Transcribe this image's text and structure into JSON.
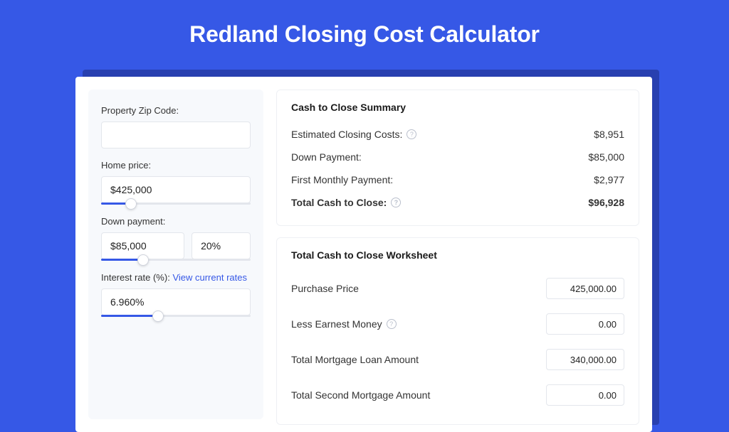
{
  "page": {
    "title": "Redland Closing Cost Calculator"
  },
  "left": {
    "zip": {
      "label": "Property Zip Code:",
      "value": ""
    },
    "home": {
      "label": "Home price:",
      "value": "$425,000",
      "slider_pct": 20
    },
    "down": {
      "label": "Down payment:",
      "value": "$85,000",
      "pct": "20%",
      "slider_pct": 28
    },
    "rate": {
      "label": "Interest rate (%):",
      "link": "View current rates",
      "value": "6.960%",
      "slider_pct": 38
    }
  },
  "summary": {
    "heading": "Cash to Close Summary",
    "rows": [
      {
        "k": "Estimated Closing Costs:",
        "info": true,
        "v": "$8,951"
      },
      {
        "k": "Down Payment:",
        "info": false,
        "v": "$85,000"
      },
      {
        "k": "First Monthly Payment:",
        "info": false,
        "v": "$2,977"
      }
    ],
    "total": {
      "k": "Total Cash to Close:",
      "info": true,
      "v": "$96,928"
    }
  },
  "worksheet": {
    "heading": "Total Cash to Close Worksheet",
    "rows": [
      {
        "k": "Purchase Price",
        "info": false,
        "v": "425,000.00"
      },
      {
        "k": "Less Earnest Money",
        "info": true,
        "v": "0.00"
      },
      {
        "k": "Total Mortgage Loan Amount",
        "info": false,
        "v": "340,000.00"
      },
      {
        "k": "Total Second Mortgage Amount",
        "info": false,
        "v": "0.00"
      }
    ]
  }
}
